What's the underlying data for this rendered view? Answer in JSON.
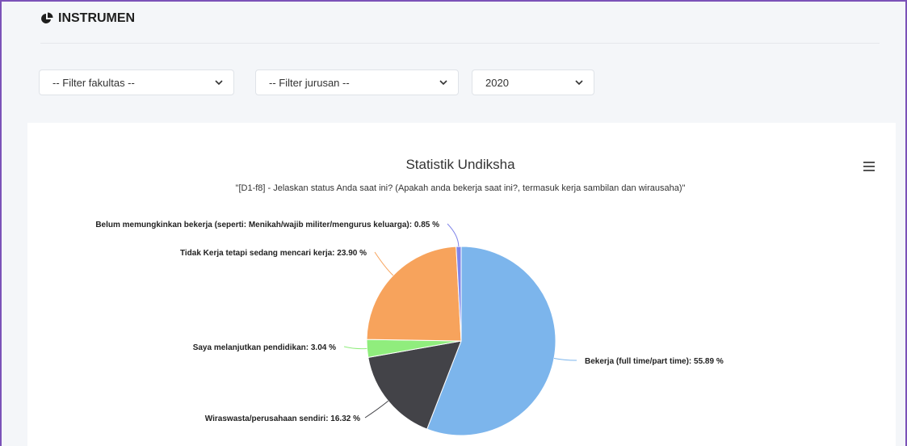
{
  "header": {
    "title": "INSTRUMEN",
    "icon": "pie-chart-icon"
  },
  "filters": {
    "fakultas": "-- Filter fakultas --",
    "jurusan": "-- Filter jurusan --",
    "year": "2020"
  },
  "chart_data": {
    "type": "pie",
    "title": "Statistik Undiksha",
    "subtitle": "\"[D1-f8] - Jelaskan status Anda saat ini? (Apakah anda bekerja saat ini?, termasuk kerja sambilan dan wirausaha)\"",
    "slices": [
      {
        "label": "Bekerja (full time/part time)",
        "value": 55.89,
        "display": "Bekerja (full time/part time): 55.89 %",
        "color": "#7cb5ec"
      },
      {
        "label": "Wiraswasta/perusahaan sendiri",
        "value": 16.32,
        "display": "Wiraswasta/perusahaan sendiri: 16.32 %",
        "color": "#434348"
      },
      {
        "label": "Saya melanjutkan pendidikan",
        "value": 3.04,
        "display": "Saya melanjutkan pendidikan: 3.04 %",
        "color": "#90ed7d"
      },
      {
        "label": "Tidak Kerja tetapi sedang mencari kerja",
        "value": 23.9,
        "display": "Tidak Kerja tetapi sedang mencari kerja: 23.90 %",
        "color": "#f7a35c"
      },
      {
        "label": "Belum memungkinkan bekerja (seperti: Menikah/wajib militer/mengurus keluarga)",
        "value": 0.85,
        "display": "Belum memungkinkan bekerja (seperti: Menikah/wajib militer/mengurus keluarga): 0.85 %",
        "color": "#8085e9"
      }
    ]
  }
}
